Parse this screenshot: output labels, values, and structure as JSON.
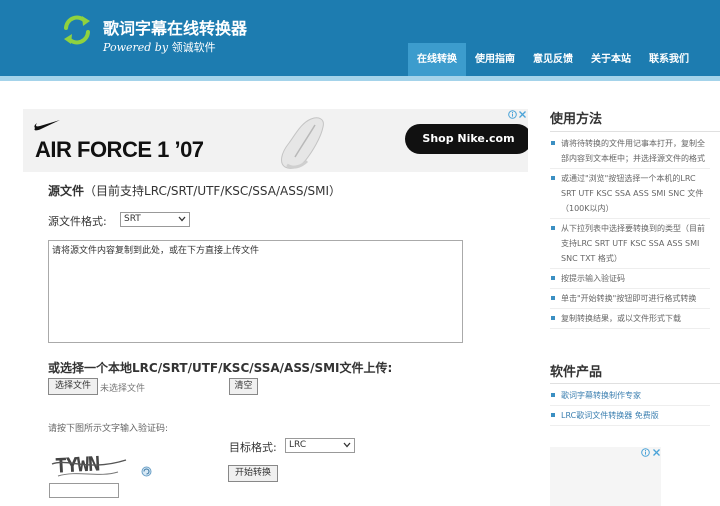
{
  "header": {
    "title": "歌词字幕在线转换器",
    "powered": "Powered by",
    "company": "领诚软件",
    "nav": [
      {
        "label": "在线转换",
        "active": true
      },
      {
        "label": "使用指南",
        "active": false
      },
      {
        "label": "意见反馈",
        "active": false
      },
      {
        "label": "关于本站",
        "active": false
      },
      {
        "label": "联系我们",
        "active": false
      }
    ]
  },
  "ad": {
    "title": "AIR FORCE 1 ’07",
    "cta": "Shop Nike.com"
  },
  "form": {
    "source_title": "源文件",
    "source_hint": "（目前支持LRC/SRT/UTF/KSC/SSA/ASS/SMI）",
    "source_format_label": "源文件格式:",
    "source_format_value": "SRT",
    "textarea_value": "请将源文件内容复制到此处，或在下方直接上传文件",
    "upload_title": "或选择一个本地LRC/SRT/UTF/KSC/SSA/ASS/SMI文件上传:",
    "choose_file_label": "选择文件",
    "no_file_text": "未选择文件",
    "clear_label": "清空",
    "captcha_label": "请按下图所示文字输入验证码:",
    "captcha_text": "TYWN",
    "target_format_label": "目标格式:",
    "target_format_value": "LRC",
    "start_label": "开始转换"
  },
  "sidebar": {
    "howto_title": "使用方法",
    "howto": [
      "请将待转换的文件用记事本打开，复制全部内容到文本框中；并选择源文件的格式",
      "或通过\"浏览\"按钮选择一个本机的LRC SRT UTF KSC SSA ASS SMI SNC 文件（100K以内）",
      "从下拉列表中选择要转换到的类型（目前支持LRC SRT UTF KSC SSA ASS SMI SNC TXT 格式）",
      "按提示输入验证码",
      "单击\"开始转换\"按钮即可进行格式转换",
      "复制转换结果，或以文件形式下载"
    ],
    "products_title": "软件产品",
    "products": [
      "歌词字幕转换制作专家",
      "LRC歌词文件转换器 免费版"
    ]
  },
  "colors": {
    "header_bg": "#1d7cb0",
    "nav_active": "#3c9ccd",
    "accent": "#3b8fc2"
  }
}
